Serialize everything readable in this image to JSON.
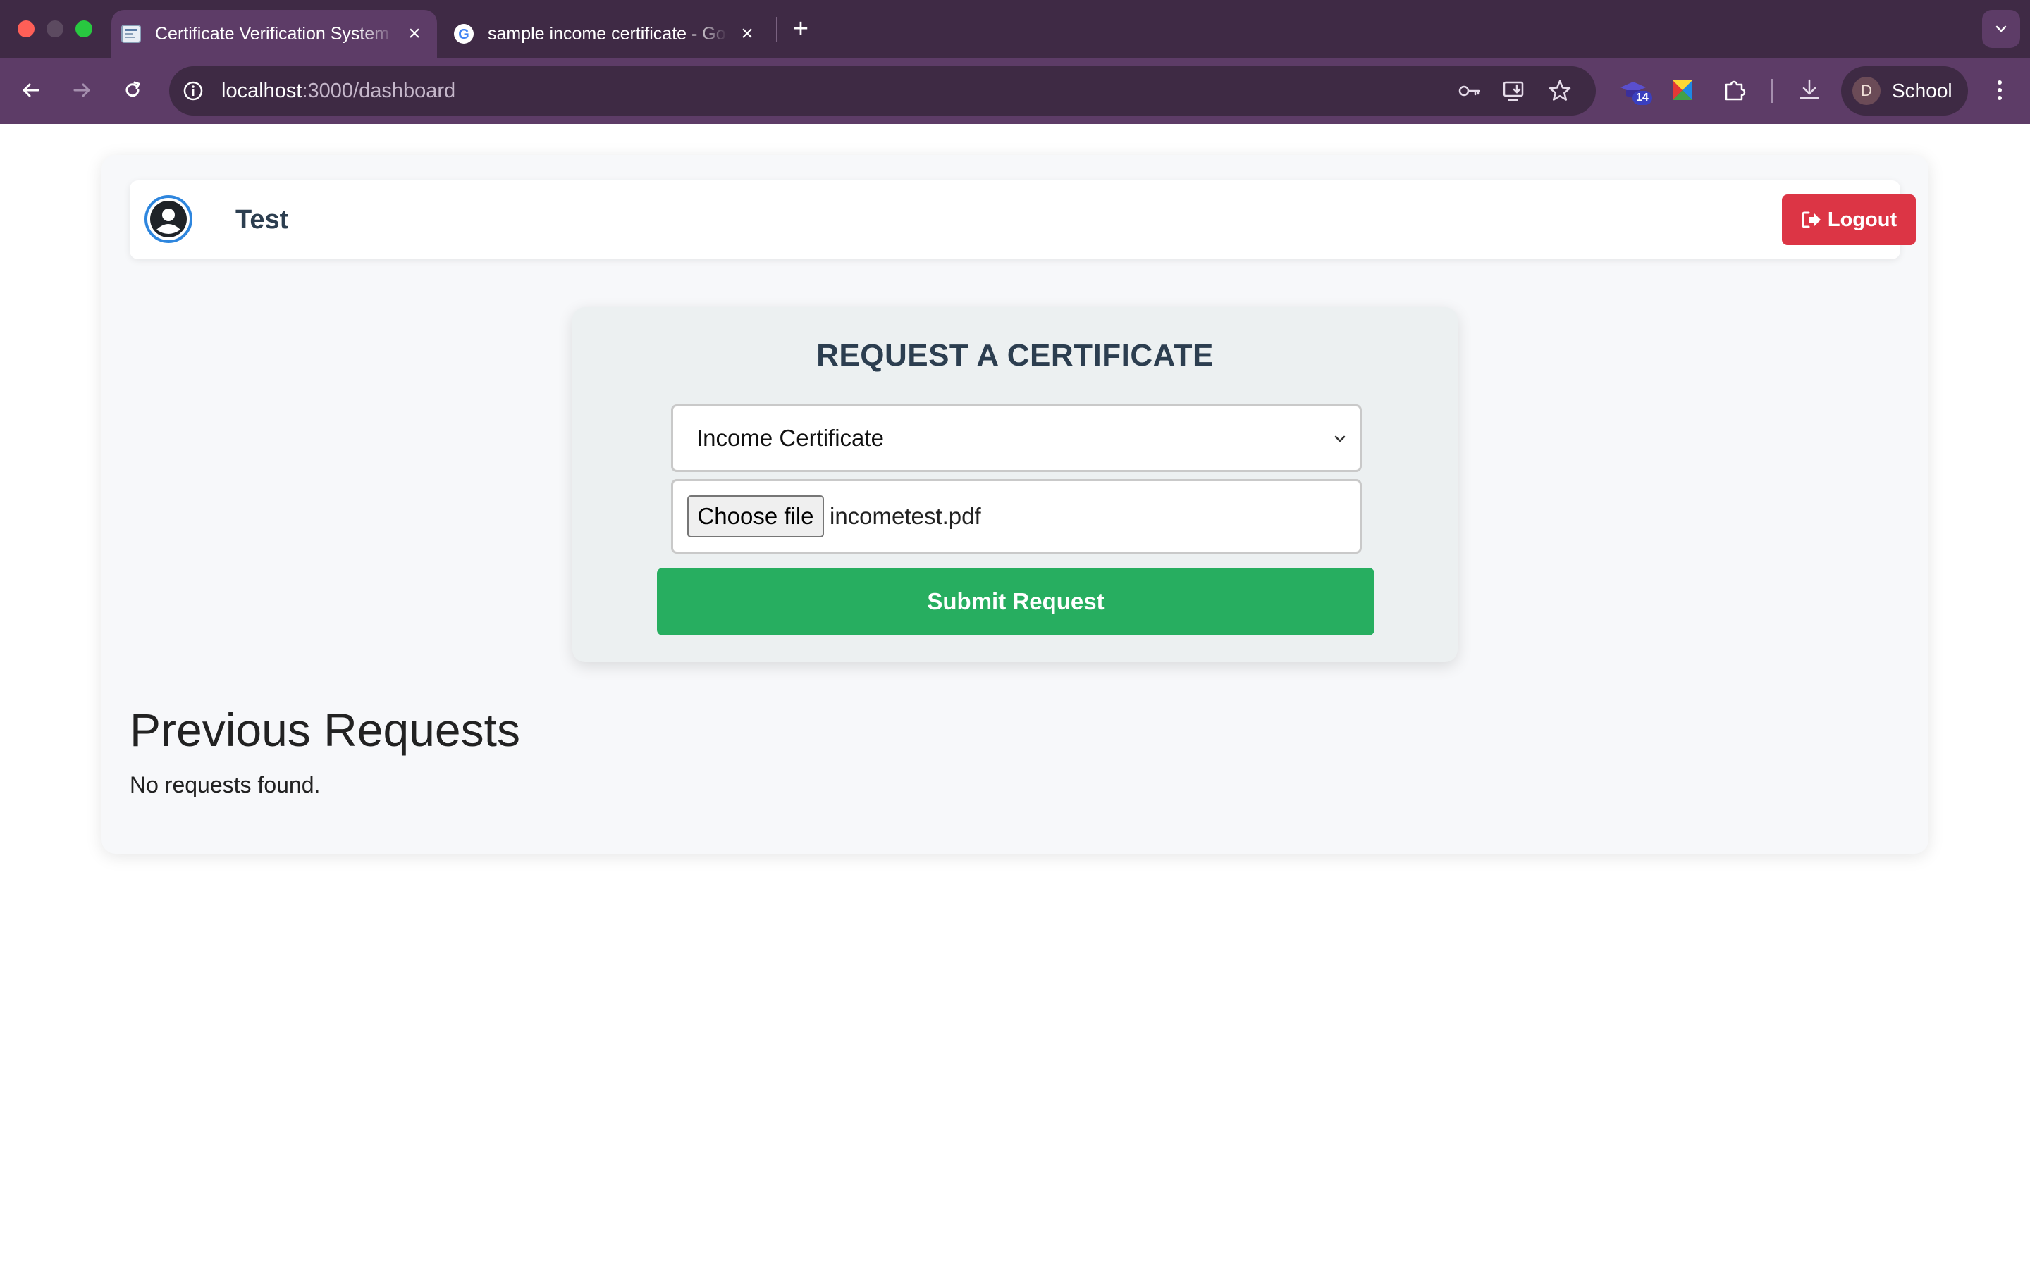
{
  "browser": {
    "tabs": [
      {
        "title": "Certificate Verification System",
        "active": true
      },
      {
        "title": "sample income certificate - Google Search",
        "active": false
      }
    ],
    "url_host": "localhost",
    "url_path": ":3000/dashboard",
    "profile_initial": "D",
    "profile_name": "School",
    "extension_badge": "14"
  },
  "header": {
    "user_name": "Test",
    "logout_label": "Logout"
  },
  "request_form": {
    "title": "REQUEST A CERTIFICATE",
    "certificate_type": "Income Certificate",
    "choose_file_label": "Choose file",
    "file_name": "incometest.pdf",
    "submit_label": "Submit Request"
  },
  "previous_requests": {
    "title": "Previous Requests",
    "empty_message": "No requests found."
  },
  "colors": {
    "logout": "#dc3545",
    "submit": "#27ae60",
    "heading": "#2c3e50",
    "browser_frame": "#5d3c67"
  }
}
